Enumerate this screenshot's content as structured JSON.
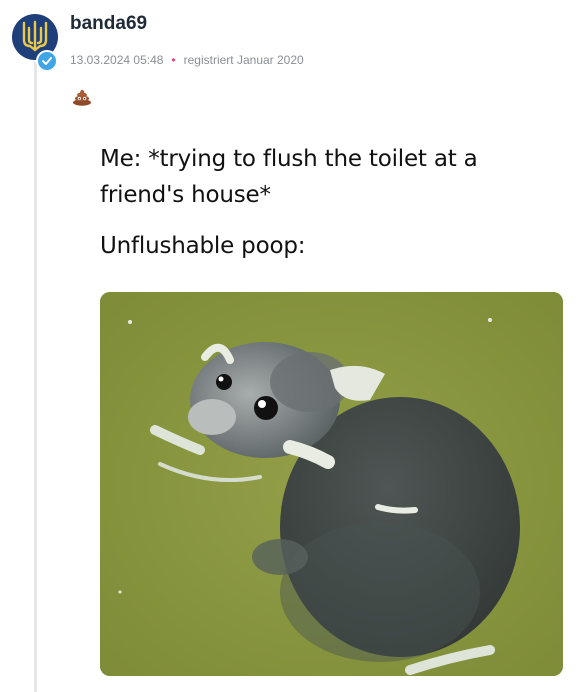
{
  "post": {
    "username": "banda69",
    "timestamp": "13.03.2024 05:48",
    "separator": "•",
    "registration": "registriert Januar 2020"
  },
  "meme": {
    "line1": "Me: *trying to flush the toilet at a",
    "line2": "friend's house*",
    "line3": "Unflushable poop:"
  },
  "icons": {
    "avatar": "ukrainian-trident-icon",
    "badge": "verified-check-icon",
    "emoji": "poop-emoji-icon"
  },
  "colors": {
    "avatar_bg": "#1f3f7a",
    "badge": "#3fa5e6",
    "water": "#8b9840",
    "seal": "#3f4548"
  }
}
